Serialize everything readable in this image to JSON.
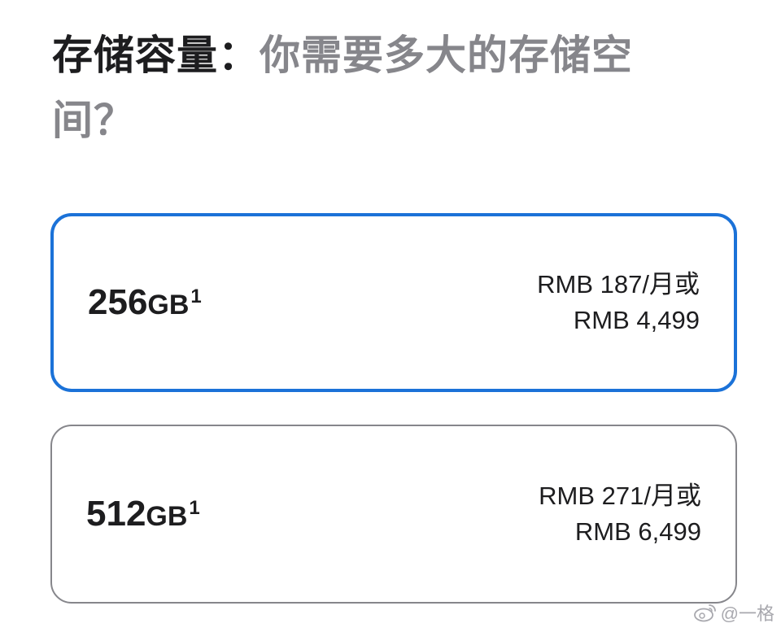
{
  "heading": {
    "strong": "存储容量：",
    "muted": "你需要多大的存储空间？"
  },
  "options": [
    {
      "capacity_number": "256",
      "capacity_unit": "GB",
      "footnote": "1",
      "price_monthly": "RMB 187/月或",
      "price_full": "RMB 4,499",
      "selected": true
    },
    {
      "capacity_number": "512",
      "capacity_unit": "GB",
      "footnote": "1",
      "price_monthly": "RMB 271/月或",
      "price_full": "RMB 6,499",
      "selected": false
    }
  ],
  "watermark": {
    "icon": "weibo-icon",
    "text": "@一格"
  },
  "colors": {
    "selected_border": "#1b72d8",
    "unselected_border": "#86868b",
    "muted_text": "#86868b",
    "primary_text": "#1d1d1f"
  }
}
